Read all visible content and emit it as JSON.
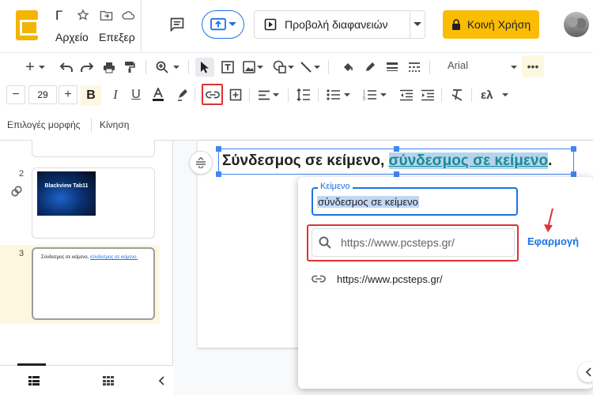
{
  "header": {
    "doc_title": "Γ",
    "menu": [
      "Αρχείο",
      "Επεξερ"
    ],
    "present_label": "Προβολή διαφανειών",
    "share_label": "Κοινή Χρήση"
  },
  "toolbar": {
    "font_name": "Arial"
  },
  "formatbar": {
    "font_size": "29",
    "lang_label": "ελ"
  },
  "context_bar": {
    "format_options": "Επιλογές μορφής",
    "motion": "Κίνηση"
  },
  "slides_panel": {
    "slides": [
      {
        "number": "2",
        "title": "Blackview Tab11"
      },
      {
        "number": "3",
        "text_plain": "Σύνδεσμος σε κείμενο,",
        "text_link": "σύνδεσμος σε κείμενο."
      }
    ]
  },
  "slide": {
    "text_plain": "Σύνδεσμος σε κείμενο, ",
    "text_link": "σύνδεσμος σε κείμενο",
    "text_end": "."
  },
  "link_popup": {
    "text_label": "Κείμενο",
    "text_value": "σύνδεσμος σε κείμενο",
    "url_value": "https://www.pcsteps.gr/",
    "apply_label": "Εφαρμογή",
    "suggestion": "https://www.pcsteps.gr/"
  },
  "colors": {
    "accent": "#1a73e8",
    "share": "#fbbc04",
    "highlight_box": "#e03131",
    "logo": "#f4b400"
  }
}
